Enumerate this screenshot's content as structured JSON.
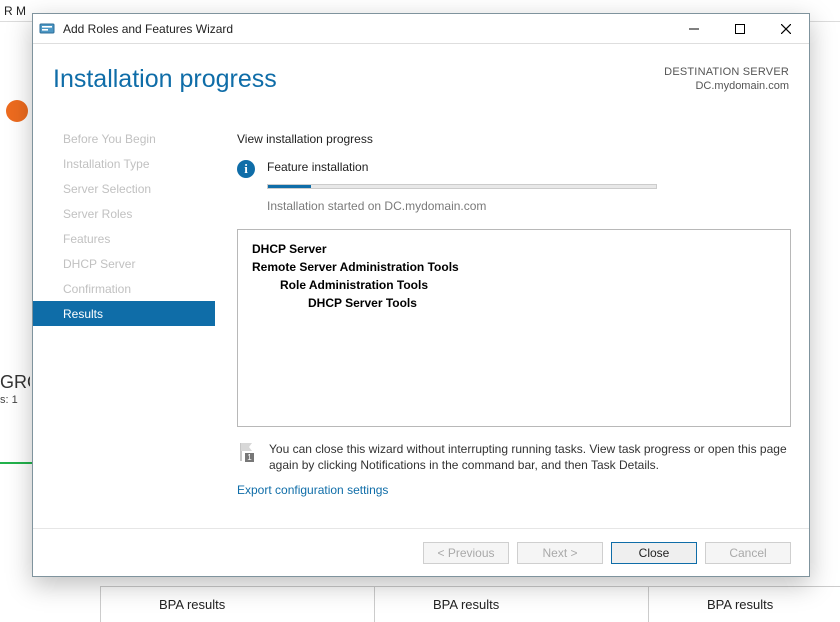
{
  "background": {
    "topbar_title": "R M",
    "group_abbr": "GRO",
    "servers_label": "s: 1",
    "bpa": "BPA results"
  },
  "dialog": {
    "titlebar": {
      "title": "Add Roles and Features Wizard"
    },
    "header": {
      "title": "Installation progress",
      "dest_label": "DESTINATION SERVER",
      "dest_server": "DC.mydomain.com"
    },
    "nav": [
      {
        "label": "Before You Begin",
        "active": false
      },
      {
        "label": "Installation Type",
        "active": false
      },
      {
        "label": "Server Selection",
        "active": false
      },
      {
        "label": "Server Roles",
        "active": false
      },
      {
        "label": "Features",
        "active": false
      },
      {
        "label": "DHCP Server",
        "active": false
      },
      {
        "label": "Confirmation",
        "active": false
      },
      {
        "label": "Results",
        "active": true
      }
    ],
    "content": {
      "view_label": "View installation progress",
      "feature_installation": "Feature installation",
      "started_on": "Installation started on DC.mydomain.com",
      "progress_percent": 11,
      "features": {
        "l0": "DHCP Server",
        "l1": "Remote Server Administration Tools",
        "l2": "Role Administration Tools",
        "l3": "DHCP Server Tools"
      },
      "hint": "You can close this wizard without interrupting running tasks. View task progress or open this page again by clicking Notifications in the command bar, and then Task Details.",
      "export_link": "Export configuration settings"
    },
    "footer": {
      "previous": "< Previous",
      "next": "Next >",
      "close": "Close",
      "cancel": "Cancel"
    }
  }
}
